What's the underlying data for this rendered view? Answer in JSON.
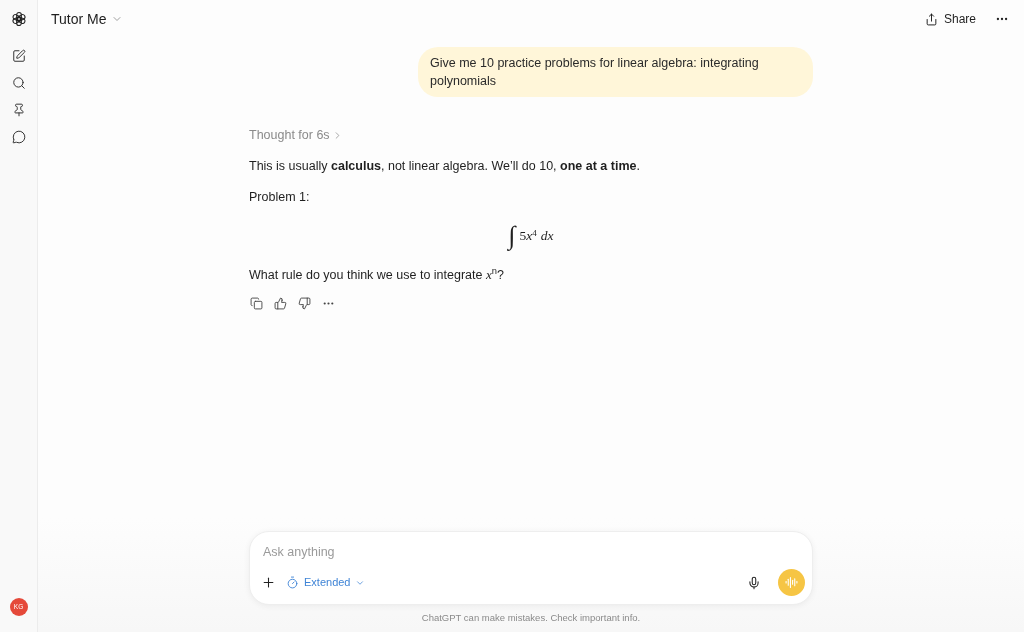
{
  "sidebar": {
    "avatar": {
      "initials": "KG",
      "color": "#e5493a"
    }
  },
  "header": {
    "title": "Tutor Me",
    "share": "Share"
  },
  "conversation": {
    "user_message": "Give me 10 practice problems for linear algebra: integrating polynomials",
    "assistant": {
      "thought": "Thought for 6s",
      "blocks": [
        {
          "kind": "text",
          "text": "This is usually **calculus**, not linear algebra. We’ll do 10, **one at a time**."
        },
        {
          "kind": "text",
          "text": "Problem 1:"
        },
        {
          "kind": "math",
          "operator": "∫",
          "coefficient": "5",
          "variable": "x",
          "exponent": "4",
          "differential": "dx"
        },
        {
          "kind": "text",
          "text": "What rule do you think we use to integrate *x*$^{n}$?"
        }
      ]
    }
  },
  "composer": {
    "placeholder": "Ask anything",
    "mode": "Extended"
  },
  "disclaimer": "ChatGPT can make mistakes. Check important info."
}
